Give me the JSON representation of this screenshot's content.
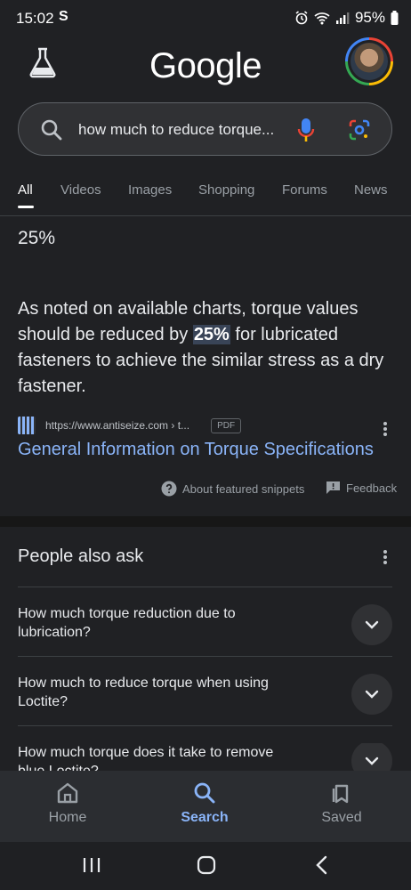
{
  "status_bar": {
    "time": "15:02",
    "app_icon": "S",
    "battery": "95%"
  },
  "header": {
    "logo": "Google"
  },
  "search": {
    "query": "how much to reduce torque..."
  },
  "tabs": [
    {
      "label": "All",
      "active": true
    },
    {
      "label": "Videos"
    },
    {
      "label": "Images"
    },
    {
      "label": "Shopping"
    },
    {
      "label": "Forums"
    },
    {
      "label": "News"
    }
  ],
  "featured_snippet": {
    "answer": "25%",
    "text_before": "As noted on available charts, torque values should be reduced by ",
    "highlight": "25%",
    "text_after": " for lubricated fasteners to achieve the similar stress as a dry fastener.",
    "source_url": "https://www.antiseize.com › t...",
    "file_type": "PDF",
    "title": "General Information on Torque Specifications",
    "about_label": "About featured snippets",
    "feedback_label": "Feedback"
  },
  "people_also_ask": {
    "title": "People also ask",
    "questions": [
      "How much torque reduction due to lubrication?",
      "How much to reduce torque when using Loctite?",
      "How much torque does it take to remove blue Loctite?"
    ]
  },
  "bottom_nav": [
    {
      "label": "Home"
    },
    {
      "label": "Search",
      "active": true
    },
    {
      "label": "Saved"
    }
  ],
  "colors": {
    "background": "#202124",
    "link": "#8ab4f8",
    "highlight": "#394457"
  }
}
